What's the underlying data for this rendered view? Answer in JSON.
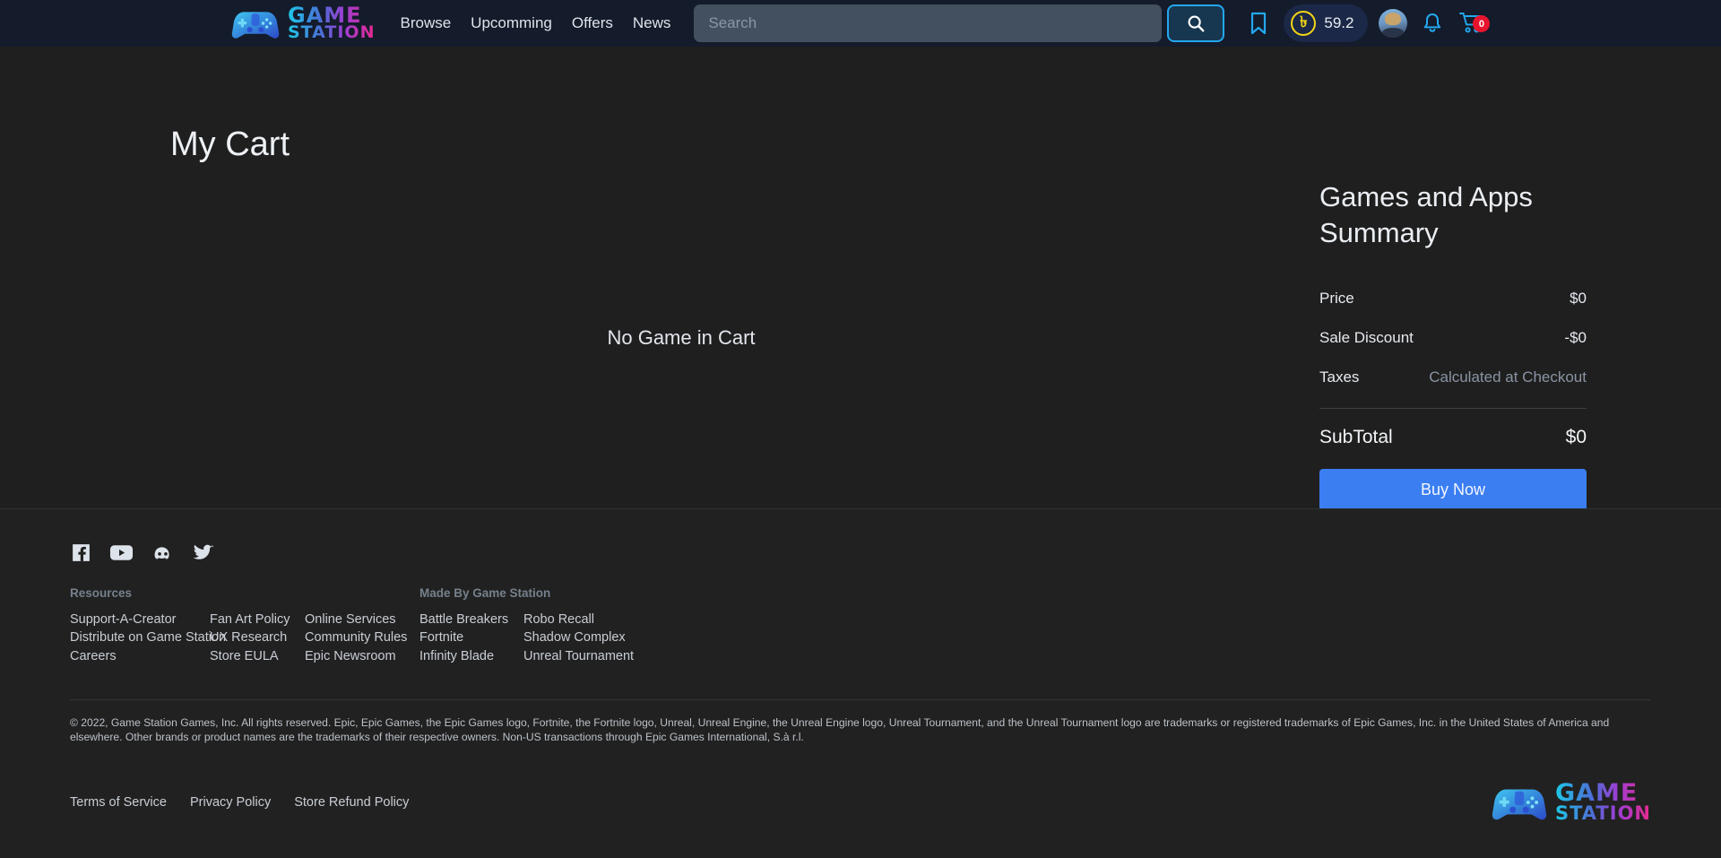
{
  "brand": {
    "name_line1": "GAME",
    "name_line2": "STATION",
    "accent_cyan": "#1ec8e8",
    "accent_magenta": "#e8298f",
    "gamepad_icon": "gamepad-icon"
  },
  "header": {
    "nav": [
      {
        "label": "Browse"
      },
      {
        "label": "Upcomming"
      },
      {
        "label": "Offers"
      },
      {
        "label": "News"
      }
    ],
    "search": {
      "value": "",
      "placeholder": "Search",
      "button_icon": "search-icon"
    },
    "bookmark_icon": "bookmark-icon",
    "wallet": {
      "currency_symbol": "৳",
      "amount": "59.2"
    },
    "avatar_icon": "avatar",
    "bell_icon": "bell-icon",
    "cart": {
      "icon": "cart-icon",
      "badge_count": "0",
      "badge_color": "#e8142d"
    }
  },
  "main": {
    "page_title": "My Cart",
    "empty_message": "No Game in Cart"
  },
  "summary": {
    "heading": "Games and Apps Summary",
    "rows": [
      {
        "label": "Price",
        "value": "$0",
        "muted": false
      },
      {
        "label": "Sale Discount",
        "value": "-$0",
        "muted": false
      },
      {
        "label": "Taxes",
        "value": "Calculated at Checkout",
        "muted": true
      }
    ],
    "subtotal": {
      "label": "SubTotal",
      "value": "$0"
    },
    "buy_button": {
      "label": "Buy Now",
      "color": "#3b7ef2"
    }
  },
  "footer": {
    "socials": [
      {
        "name": "facebook-icon"
      },
      {
        "name": "youtube-icon"
      },
      {
        "name": "discord-icon"
      },
      {
        "name": "twitter-icon"
      }
    ],
    "columns": [
      {
        "heading": "Resources",
        "links": [
          "Support-A-Creator",
          "Distribute on Game Station",
          "Careers"
        ]
      },
      {
        "heading": "",
        "links": [
          "Fan Art Policy",
          "UX Research",
          "Store EULA"
        ]
      },
      {
        "heading": "",
        "links": [
          "Online Services",
          "Community Rules",
          "Epic Newsroom"
        ]
      },
      {
        "heading": "Made By Game Station",
        "links": [
          "Battle Breakers",
          "Fortnite",
          "Infinity Blade"
        ]
      },
      {
        "heading": "",
        "links": [
          "Robo Recall",
          "Shadow Complex",
          "Unreal Tournament"
        ]
      }
    ],
    "copyright": "© 2022, Game Station Games, Inc. All rights reserved. Epic, Epic Games, the Epic Games logo, Fortnite, the Fortnite logo, Unreal, Unreal Engine, the Unreal Engine logo, Unreal Tournament, and the Unreal Tournament logo are trademarks or registered trademarks of Epic Games, Inc. in the United States of America and elsewhere. Other brands or product names are the trademarks of their respective owners. Non-US transactions through Epic Games International, S.à r.l.",
    "bottom_links": [
      "Terms of Service",
      "Privacy Policy",
      "Store Refund Policy"
    ]
  }
}
